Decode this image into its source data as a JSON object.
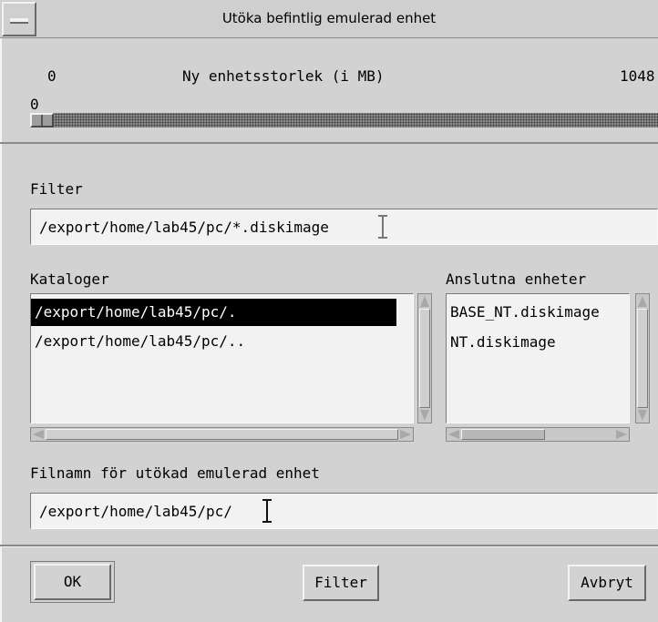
{
  "window": {
    "title": "Utöka befintlig emulerad enhet"
  },
  "size_scale": {
    "min_label": "0",
    "label": "Ny enhetsstorlek (i MB)",
    "max_label": "1048",
    "value_label": "0",
    "value": 0
  },
  "filter": {
    "label": "Filter",
    "value": "/export/home/lab45/pc/*.diskimage"
  },
  "directories": {
    "label": "Kataloger",
    "items": [
      "/export/home/lab45/pc/.",
      "/export/home/lab45/pc/.."
    ],
    "selected_index": 0
  },
  "devices": {
    "label": "Anslutna enheter",
    "items": [
      "BASE_NT.diskimage",
      "NT.diskimage"
    ]
  },
  "filename": {
    "label": "Filnamn för utökad emulerad enhet",
    "value": "/export/home/lab45/pc/"
  },
  "buttons": {
    "ok": "OK",
    "filter": "Filter",
    "cancel": "Avbryt"
  }
}
